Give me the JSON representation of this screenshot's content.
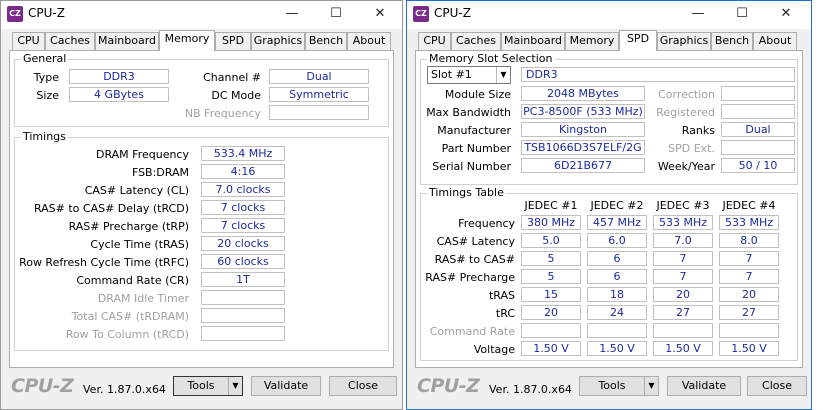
{
  "left": {
    "title": "CPU-Z",
    "tabs": [
      "CPU",
      "Caches",
      "Mainboard",
      "Memory",
      "SPD",
      "Graphics",
      "Bench",
      "About"
    ],
    "active_tab": "Memory",
    "general": {
      "title": "General",
      "type_label": "Type",
      "type_value": "DDR3",
      "size_label": "Size",
      "size_value": "4 GBytes",
      "channel_label": "Channel #",
      "channel_value": "Dual",
      "dc_mode_label": "DC Mode",
      "dc_mode_value": "Symmetric",
      "nb_freq_label": "NB Frequency",
      "nb_freq_value": ""
    },
    "timings": {
      "title": "Timings",
      "rows": [
        {
          "label": "DRAM Frequency",
          "value": "533.4 MHz",
          "dim": false
        },
        {
          "label": "FSB:DRAM",
          "value": "4:16",
          "dim": false
        },
        {
          "label": "CAS# Latency (CL)",
          "value": "7.0 clocks",
          "dim": false
        },
        {
          "label": "RAS# to CAS# Delay (tRCD)",
          "value": "7 clocks",
          "dim": false
        },
        {
          "label": "RAS# Precharge (tRP)",
          "value": "7 clocks",
          "dim": false
        },
        {
          "label": "Cycle Time (tRAS)",
          "value": "20 clocks",
          "dim": false
        },
        {
          "label": "Row Refresh Cycle Time (tRFC)",
          "value": "60 clocks",
          "dim": false
        },
        {
          "label": "Command Rate (CR)",
          "value": "1T",
          "dim": false
        },
        {
          "label": "DRAM Idle Timer",
          "value": "",
          "dim": true
        },
        {
          "label": "Total CAS# (tRDRAM)",
          "value": "",
          "dim": true
        },
        {
          "label": "Row To Column (tRCD)",
          "value": "",
          "dim": true
        }
      ]
    },
    "footer": {
      "brand": "CPU-Z",
      "version": "Ver. 1.87.0.x64",
      "tools": "Tools",
      "validate": "Validate",
      "close": "Close"
    }
  },
  "right": {
    "title": "CPU-Z",
    "tabs": [
      "CPU",
      "Caches",
      "Mainboard",
      "Memory",
      "SPD",
      "Graphics",
      "Bench",
      "About"
    ],
    "active_tab": "SPD",
    "slot_group_title": "Memory Slot Selection",
    "slot_selected": "Slot #1",
    "memory_type": "DDR3",
    "module_size_label": "Module Size",
    "module_size": "2048 MBytes",
    "max_bandwidth_label": "Max Bandwidth",
    "max_bandwidth": "PC3-8500F (533 MHz)",
    "manufacturer_label": "Manufacturer",
    "manufacturer": "Kingston",
    "part_number_label": "Part Number",
    "part_number": "TSB1066D3S7ELF/2G",
    "serial_number_label": "Serial Number",
    "serial_number": "6D21B677",
    "correction_label": "Correction",
    "correction": "",
    "registered_label": "Registered",
    "registered": "",
    "ranks_label": "Ranks",
    "ranks": "Dual",
    "spd_ext_label": "SPD Ext.",
    "spd_ext": "",
    "week_year_label": "Week/Year",
    "week_year": "50 / 10",
    "timings_table": {
      "title": "Timings Table",
      "columns": [
        "JEDEC #1",
        "JEDEC #2",
        "JEDEC #3",
        "JEDEC #4"
      ],
      "rows": [
        {
          "label": "Frequency",
          "values": [
            "380 MHz",
            "457 MHz",
            "533 MHz",
            "533 MHz"
          ],
          "dim": false
        },
        {
          "label": "CAS# Latency",
          "values": [
            "5.0",
            "6.0",
            "7.0",
            "8.0"
          ],
          "dim": false
        },
        {
          "label": "RAS# to CAS#",
          "values": [
            "5",
            "6",
            "7",
            "7"
          ],
          "dim": false
        },
        {
          "label": "RAS# Precharge",
          "values": [
            "5",
            "6",
            "7",
            "7"
          ],
          "dim": false
        },
        {
          "label": "tRAS",
          "values": [
            "15",
            "18",
            "20",
            "20"
          ],
          "dim": false
        },
        {
          "label": "tRC",
          "values": [
            "20",
            "24",
            "27",
            "27"
          ],
          "dim": false
        },
        {
          "label": "Command Rate",
          "values": [
            "",
            "",
            "",
            ""
          ],
          "dim": true
        },
        {
          "label": "Voltage",
          "values": [
            "1.50 V",
            "1.50 V",
            "1.50 V",
            "1.50 V"
          ],
          "dim": false
        }
      ]
    },
    "footer": {
      "brand": "CPU-Z",
      "version": "Ver. 1.87.0.x64",
      "tools": "Tools",
      "validate": "Validate",
      "close": "Close"
    }
  },
  "window_controls": {
    "minimize": "—",
    "maximize": "☐",
    "close": "✕"
  },
  "colors": {
    "value_text": "#1a2aa0",
    "active_border": "#1e6fc8",
    "app_icon": "#7b2a8c"
  }
}
